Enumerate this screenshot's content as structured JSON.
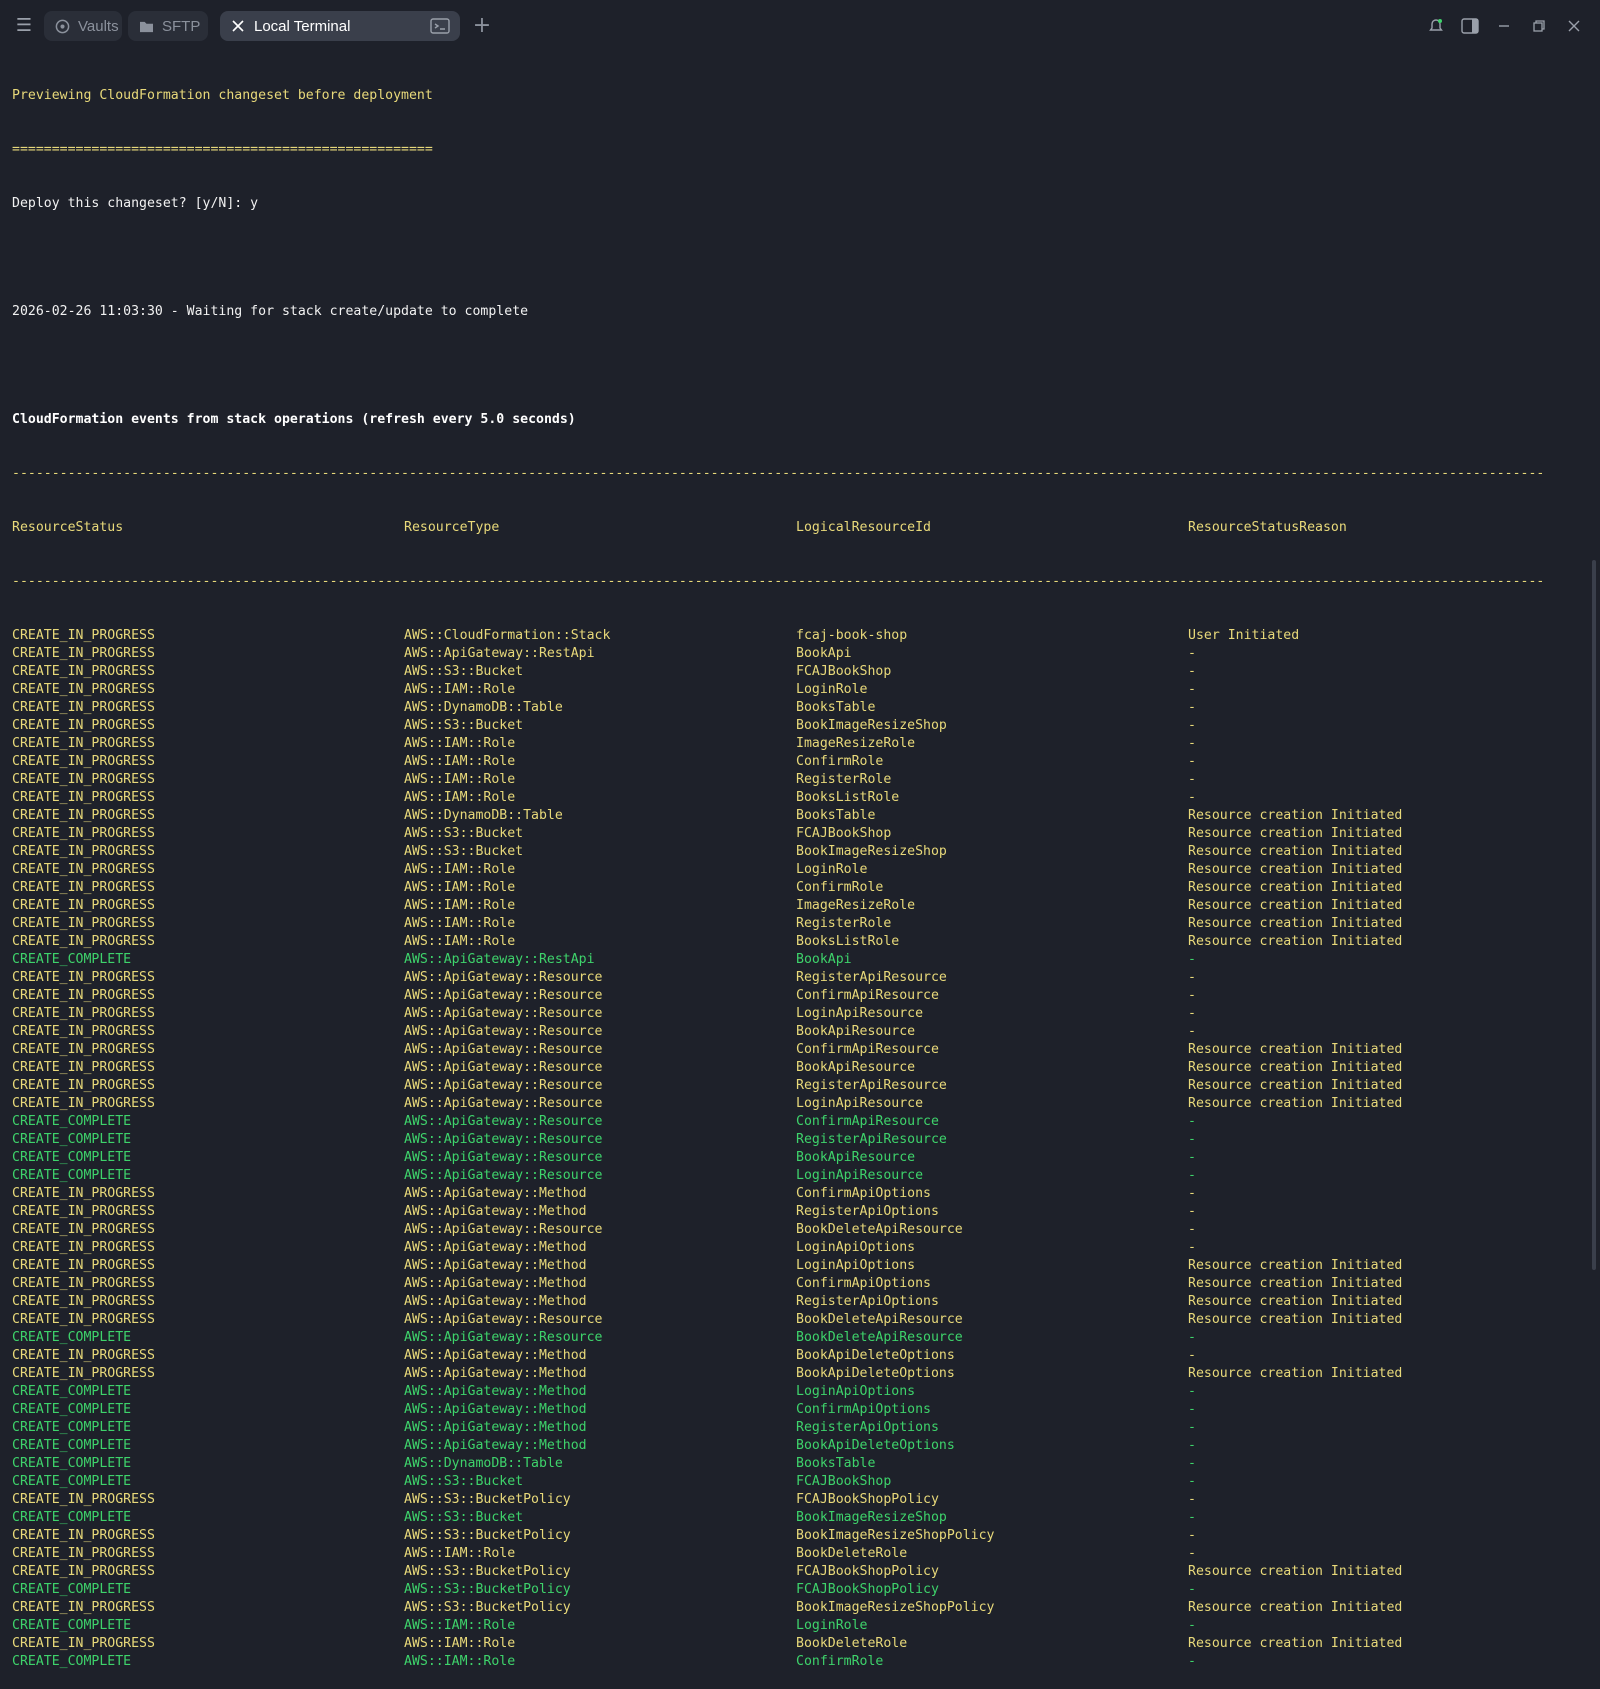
{
  "tabs": [
    {
      "label": "Vaults",
      "icon": "vault-icon"
    },
    {
      "label": "SFTP",
      "icon": "folder-icon"
    },
    {
      "label": "Local Terminal",
      "icon": "close-icon",
      "active": true
    }
  ],
  "terminal": {
    "preview_line": "Previewing CloudFormation changeset before deployment",
    "separator_eq": "=====================================================",
    "deploy_prompt": "Deploy this changeset? [y/N]: y",
    "waiting_line": "2026-02-26 11:03:30 - Waiting for stack create/update to complete",
    "events_heading": "CloudFormation events from stack operations (refresh every 5.0 seconds)",
    "separator_dash": "-------------------------------------------------------------------------------------------------------------------------------------------------------------------------------------------------",
    "headers": [
      "ResourceStatus",
      "ResourceType",
      "LogicalResourceId",
      "ResourceStatusReason"
    ],
    "events": [
      [
        "CREATE_IN_PROGRESS",
        "AWS::CloudFormation::Stack",
        "fcaj-book-shop",
        "User Initiated"
      ],
      [
        "CREATE_IN_PROGRESS",
        "AWS::ApiGateway::RestApi",
        "BookApi",
        "-"
      ],
      [
        "CREATE_IN_PROGRESS",
        "AWS::S3::Bucket",
        "FCAJBookShop",
        "-"
      ],
      [
        "CREATE_IN_PROGRESS",
        "AWS::IAM::Role",
        "LoginRole",
        "-"
      ],
      [
        "CREATE_IN_PROGRESS",
        "AWS::DynamoDB::Table",
        "BooksTable",
        "-"
      ],
      [
        "CREATE_IN_PROGRESS",
        "AWS::S3::Bucket",
        "BookImageResizeShop",
        "-"
      ],
      [
        "CREATE_IN_PROGRESS",
        "AWS::IAM::Role",
        "ImageResizeRole",
        "-"
      ],
      [
        "CREATE_IN_PROGRESS",
        "AWS::IAM::Role",
        "ConfirmRole",
        "-"
      ],
      [
        "CREATE_IN_PROGRESS",
        "AWS::IAM::Role",
        "RegisterRole",
        "-"
      ],
      [
        "CREATE_IN_PROGRESS",
        "AWS::IAM::Role",
        "BooksListRole",
        "-"
      ],
      [
        "CREATE_IN_PROGRESS",
        "AWS::DynamoDB::Table",
        "BooksTable",
        "Resource creation Initiated"
      ],
      [
        "CREATE_IN_PROGRESS",
        "AWS::S3::Bucket",
        "FCAJBookShop",
        "Resource creation Initiated"
      ],
      [
        "CREATE_IN_PROGRESS",
        "AWS::S3::Bucket",
        "BookImageResizeShop",
        "Resource creation Initiated"
      ],
      [
        "CREATE_IN_PROGRESS",
        "AWS::IAM::Role",
        "LoginRole",
        "Resource creation Initiated"
      ],
      [
        "CREATE_IN_PROGRESS",
        "AWS::IAM::Role",
        "ConfirmRole",
        "Resource creation Initiated"
      ],
      [
        "CREATE_IN_PROGRESS",
        "AWS::IAM::Role",
        "ImageResizeRole",
        "Resource creation Initiated"
      ],
      [
        "CREATE_IN_PROGRESS",
        "AWS::IAM::Role",
        "RegisterRole",
        "Resource creation Initiated"
      ],
      [
        "CREATE_IN_PROGRESS",
        "AWS::IAM::Role",
        "BooksListRole",
        "Resource creation Initiated"
      ],
      [
        "CREATE_COMPLETE",
        "AWS::ApiGateway::RestApi",
        "BookApi",
        "-"
      ],
      [
        "CREATE_IN_PROGRESS",
        "AWS::ApiGateway::Resource",
        "RegisterApiResource",
        "-"
      ],
      [
        "CREATE_IN_PROGRESS",
        "AWS::ApiGateway::Resource",
        "ConfirmApiResource",
        "-"
      ],
      [
        "CREATE_IN_PROGRESS",
        "AWS::ApiGateway::Resource",
        "LoginApiResource",
        "-"
      ],
      [
        "CREATE_IN_PROGRESS",
        "AWS::ApiGateway::Resource",
        "BookApiResource",
        "-"
      ],
      [
        "CREATE_IN_PROGRESS",
        "AWS::ApiGateway::Resource",
        "ConfirmApiResource",
        "Resource creation Initiated"
      ],
      [
        "CREATE_IN_PROGRESS",
        "AWS::ApiGateway::Resource",
        "BookApiResource",
        "Resource creation Initiated"
      ],
      [
        "CREATE_IN_PROGRESS",
        "AWS::ApiGateway::Resource",
        "RegisterApiResource",
        "Resource creation Initiated"
      ],
      [
        "CREATE_IN_PROGRESS",
        "AWS::ApiGateway::Resource",
        "LoginApiResource",
        "Resource creation Initiated"
      ],
      [
        "CREATE_COMPLETE",
        "AWS::ApiGateway::Resource",
        "ConfirmApiResource",
        "-"
      ],
      [
        "CREATE_COMPLETE",
        "AWS::ApiGateway::Resource",
        "RegisterApiResource",
        "-"
      ],
      [
        "CREATE_COMPLETE",
        "AWS::ApiGateway::Resource",
        "BookApiResource",
        "-"
      ],
      [
        "CREATE_COMPLETE",
        "AWS::ApiGateway::Resource",
        "LoginApiResource",
        "-"
      ],
      [
        "CREATE_IN_PROGRESS",
        "AWS::ApiGateway::Method",
        "ConfirmApiOptions",
        "-"
      ],
      [
        "CREATE_IN_PROGRESS",
        "AWS::ApiGateway::Method",
        "RegisterApiOptions",
        "-"
      ],
      [
        "CREATE_IN_PROGRESS",
        "AWS::ApiGateway::Resource",
        "BookDeleteApiResource",
        "-"
      ],
      [
        "CREATE_IN_PROGRESS",
        "AWS::ApiGateway::Method",
        "LoginApiOptions",
        "-"
      ],
      [
        "CREATE_IN_PROGRESS",
        "AWS::ApiGateway::Method",
        "LoginApiOptions",
        "Resource creation Initiated"
      ],
      [
        "CREATE_IN_PROGRESS",
        "AWS::ApiGateway::Method",
        "ConfirmApiOptions",
        "Resource creation Initiated"
      ],
      [
        "CREATE_IN_PROGRESS",
        "AWS::ApiGateway::Method",
        "RegisterApiOptions",
        "Resource creation Initiated"
      ],
      [
        "CREATE_IN_PROGRESS",
        "AWS::ApiGateway::Resource",
        "BookDeleteApiResource",
        "Resource creation Initiated"
      ],
      [
        "CREATE_COMPLETE",
        "AWS::ApiGateway::Resource",
        "BookDeleteApiResource",
        "-"
      ],
      [
        "CREATE_IN_PROGRESS",
        "AWS::ApiGateway::Method",
        "BookApiDeleteOptions",
        "-"
      ],
      [
        "CREATE_IN_PROGRESS",
        "AWS::ApiGateway::Method",
        "BookApiDeleteOptions",
        "Resource creation Initiated"
      ],
      [
        "CREATE_COMPLETE",
        "AWS::ApiGateway::Method",
        "LoginApiOptions",
        "-"
      ],
      [
        "CREATE_COMPLETE",
        "AWS::ApiGateway::Method",
        "ConfirmApiOptions",
        "-"
      ],
      [
        "CREATE_COMPLETE",
        "AWS::ApiGateway::Method",
        "RegisterApiOptions",
        "-"
      ],
      [
        "CREATE_COMPLETE",
        "AWS::ApiGateway::Method",
        "BookApiDeleteOptions",
        "-"
      ],
      [
        "CREATE_COMPLETE",
        "AWS::DynamoDB::Table",
        "BooksTable",
        "-"
      ],
      [
        "CREATE_COMPLETE",
        "AWS::S3::Bucket",
        "FCAJBookShop",
        "-"
      ],
      [
        "CREATE_IN_PROGRESS",
        "AWS::S3::BucketPolicy",
        "FCAJBookShopPolicy",
        "-"
      ],
      [
        "CREATE_COMPLETE",
        "AWS::S3::Bucket",
        "BookImageResizeShop",
        "-"
      ],
      [
        "CREATE_IN_PROGRESS",
        "AWS::S3::BucketPolicy",
        "BookImageResizeShopPolicy",
        "-"
      ],
      [
        "CREATE_IN_PROGRESS",
        "AWS::IAM::Role",
        "BookDeleteRole",
        "-"
      ],
      [
        "CREATE_IN_PROGRESS",
        "AWS::S3::BucketPolicy",
        "FCAJBookShopPolicy",
        "Resource creation Initiated"
      ],
      [
        "CREATE_COMPLETE",
        "AWS::S3::BucketPolicy",
        "FCAJBookShopPolicy",
        "-"
      ],
      [
        "CREATE_IN_PROGRESS",
        "AWS::S3::BucketPolicy",
        "BookImageResizeShopPolicy",
        "Resource creation Initiated"
      ],
      [
        "CREATE_COMPLETE",
        "AWS::IAM::Role",
        "LoginRole",
        "-"
      ],
      [
        "CREATE_IN_PROGRESS",
        "AWS::IAM::Role",
        "BookDeleteRole",
        "Resource creation Initiated"
      ],
      [
        "CREATE_COMPLETE",
        "AWS::IAM::Role",
        "ConfirmRole",
        "-"
      ]
    ]
  },
  "colors": {
    "background": "#1e212a",
    "in_progress": "#e8d97a",
    "complete": "#3ed36b",
    "active_tab": "#3a3f4b"
  }
}
